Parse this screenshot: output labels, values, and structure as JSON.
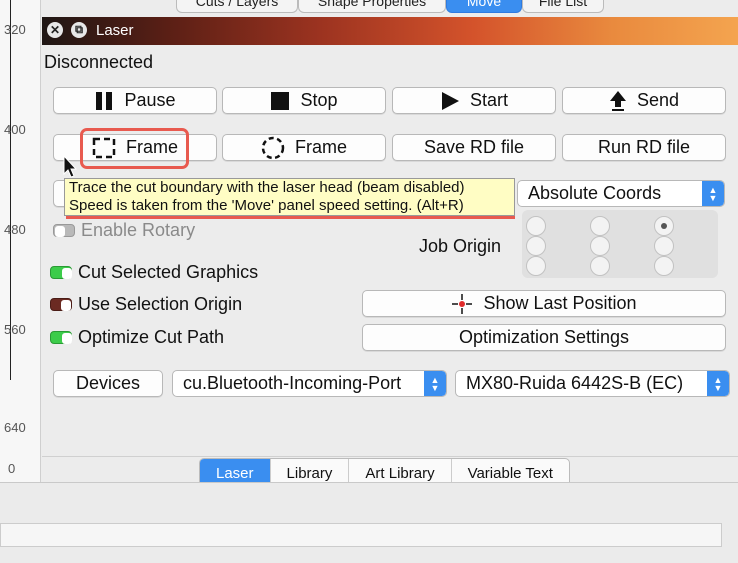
{
  "ruler": {
    "labels": [
      "320",
      "400",
      "480",
      "560",
      "640",
      "0"
    ]
  },
  "top_tabs": [
    {
      "label": "Cuts / Layers",
      "active": false
    },
    {
      "label": "Shape Properties",
      "active": false
    },
    {
      "label": "Move",
      "active": true
    },
    {
      "label": "File List",
      "active": false
    }
  ],
  "window": {
    "title": "Laser",
    "close_glyph": "✕",
    "restore_glyph": "⧉"
  },
  "status": "Disconnected",
  "buttons": {
    "pause": "Pause",
    "stop": "Stop",
    "start": "Start",
    "send": "Send",
    "frame_rect": "Frame",
    "frame_circle": "Frame",
    "save_rd": "Save RD file",
    "run_rd": "Run RD file",
    "show_last_position": "Show Last Position",
    "optimization_settings": "Optimization Settings",
    "devices": "Devices"
  },
  "tooltip": {
    "line1": "Trace the cut boundary with the laser head (beam disabled)",
    "line2": "Speed is taken from the 'Move' panel speed setting. (Alt+R)"
  },
  "coords_select": {
    "value": "Absolute Coords"
  },
  "toggles": {
    "enable_rotary": {
      "label": "Enable Rotary",
      "state": "off"
    },
    "cut_selected": {
      "label": "Cut Selected Graphics",
      "state": "on"
    },
    "use_selection_origin": {
      "label": "Use Selection Origin",
      "state": "dark"
    },
    "optimize_cut_path": {
      "label": "Optimize Cut Path",
      "state": "on"
    }
  },
  "job_origin": {
    "label": "Job Origin",
    "selected": "top-right"
  },
  "port_select": {
    "value": "cu.Bluetooth-Incoming-Port"
  },
  "device_select": {
    "value": "MX80-Ruida 6442S-B (EC)"
  },
  "bottom_tabs": [
    {
      "label": "Laser",
      "active": true
    },
    {
      "label": "Library",
      "active": false
    },
    {
      "label": "Art Library",
      "active": false
    },
    {
      "label": "Variable Text",
      "active": false
    }
  ],
  "colors": {
    "accent": "#3a8ef0",
    "highlight": "#e85a4f",
    "tooltip_bg": "#fffdc4",
    "toggle_on": "#3ccc4a"
  }
}
